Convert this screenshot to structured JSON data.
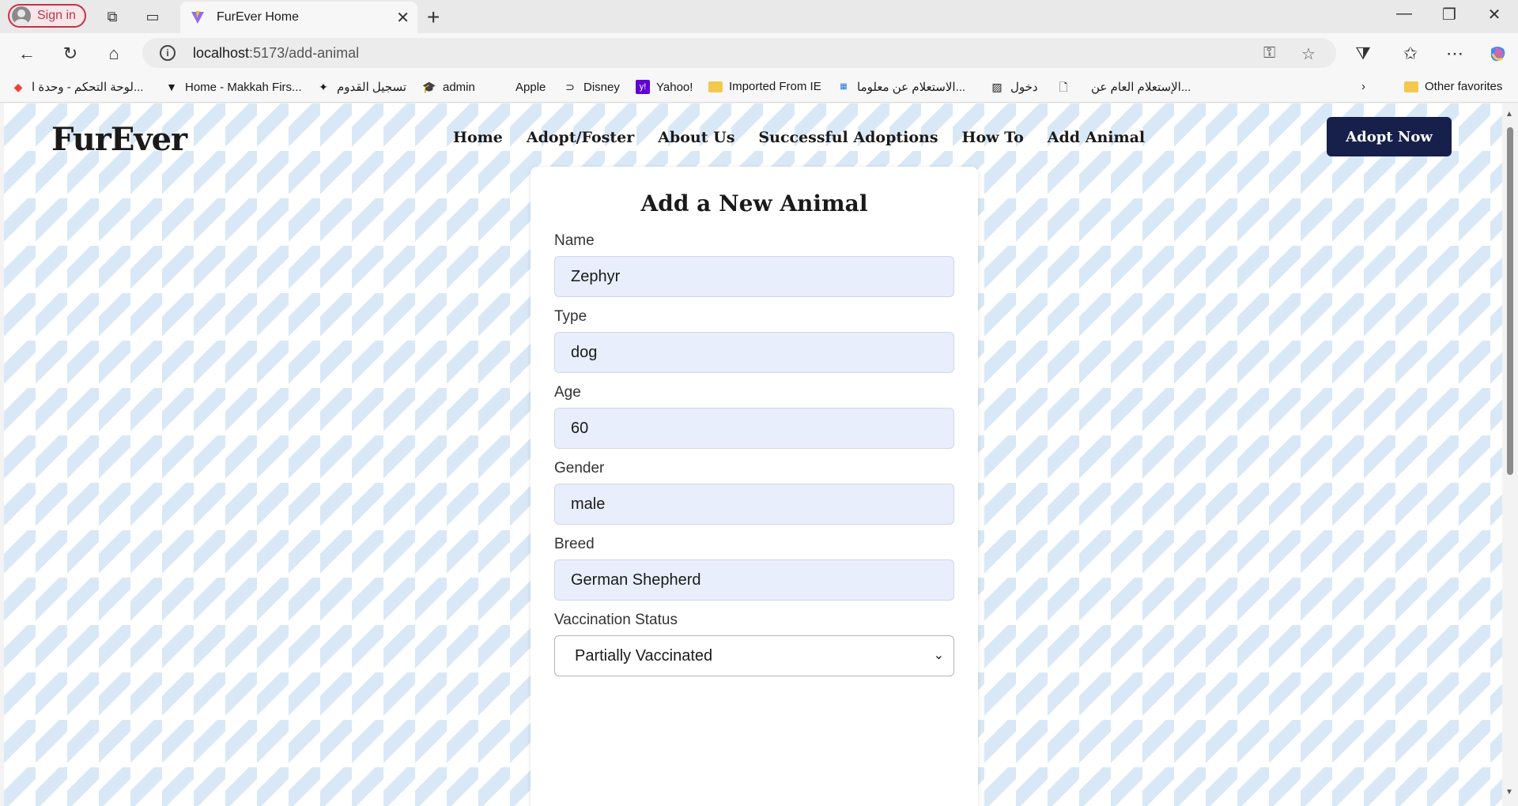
{
  "browser": {
    "signin_label": "Sign in",
    "tab_title": "FurEver Home",
    "url_host": "localhost",
    "url_path": ":5173/add-animal",
    "bookmarks": [
      "لوحة التحكم - وحدة ا...",
      "Home - Makkah Firs...",
      "تسجيل القدوم",
      "admin",
      "Apple",
      "Disney",
      "Yahoo!",
      "Imported From IE",
      "الاستعلام عن معلوما...",
      "دخول",
      "الإستعلام العام عن..."
    ],
    "other_favorites": "Other favorites"
  },
  "site": {
    "brand": "FurEver",
    "nav": [
      "Home",
      "Adopt/Foster",
      "About Us",
      "Successful Adoptions",
      "How To",
      "Add Animal"
    ],
    "cta": "Adopt Now"
  },
  "form": {
    "title": "Add a New Animal",
    "fields": [
      {
        "label": "Name",
        "value": "Zephyr"
      },
      {
        "label": "Type",
        "value": "dog"
      },
      {
        "label": "Age",
        "value": "60"
      },
      {
        "label": "Gender",
        "value": "male"
      },
      {
        "label": "Breed",
        "value": "German Shepherd"
      }
    ],
    "vaccination": {
      "label": "Vaccination Status",
      "value": "Partially Vaccinated"
    }
  },
  "colors": {
    "brand_navy": "#16204a",
    "input_bg": "#e8eefb",
    "pattern_blue": "#d9e8f6"
  }
}
